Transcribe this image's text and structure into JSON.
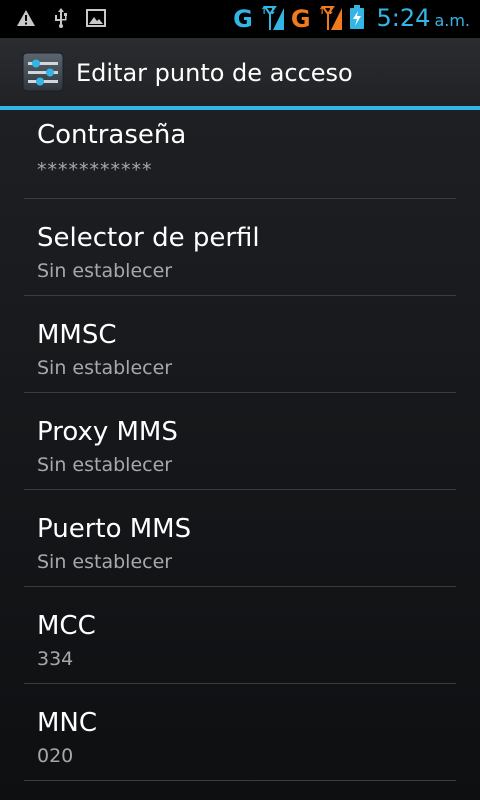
{
  "status_bar": {
    "network_type_1": "G",
    "network_type_2": "G",
    "clock_time": "5:24",
    "clock_ampm": "a.m.",
    "icons": [
      "warning-icon",
      "usb-icon",
      "image-icon",
      "signal-sim1-icon",
      "signal-sim2-icon",
      "battery-charging-icon"
    ],
    "colors": {
      "accent": "#33b5e5",
      "sim2": "#f07a1e"
    }
  },
  "action_bar": {
    "title": "Editar punto de acceso",
    "icon": "settings-sliders-icon"
  },
  "preferences": [
    {
      "title": "Contraseña",
      "summary": "***********"
    },
    {
      "title": "Selector de perfil",
      "summary": "Sin establecer"
    },
    {
      "title": "MMSC",
      "summary": "Sin establecer"
    },
    {
      "title": "Proxy MMS",
      "summary": "Sin establecer"
    },
    {
      "title": "Puerto MMS",
      "summary": "Sin establecer"
    },
    {
      "title": "MCC",
      "summary": "334"
    },
    {
      "title": "MNC",
      "summary": "020"
    }
  ]
}
